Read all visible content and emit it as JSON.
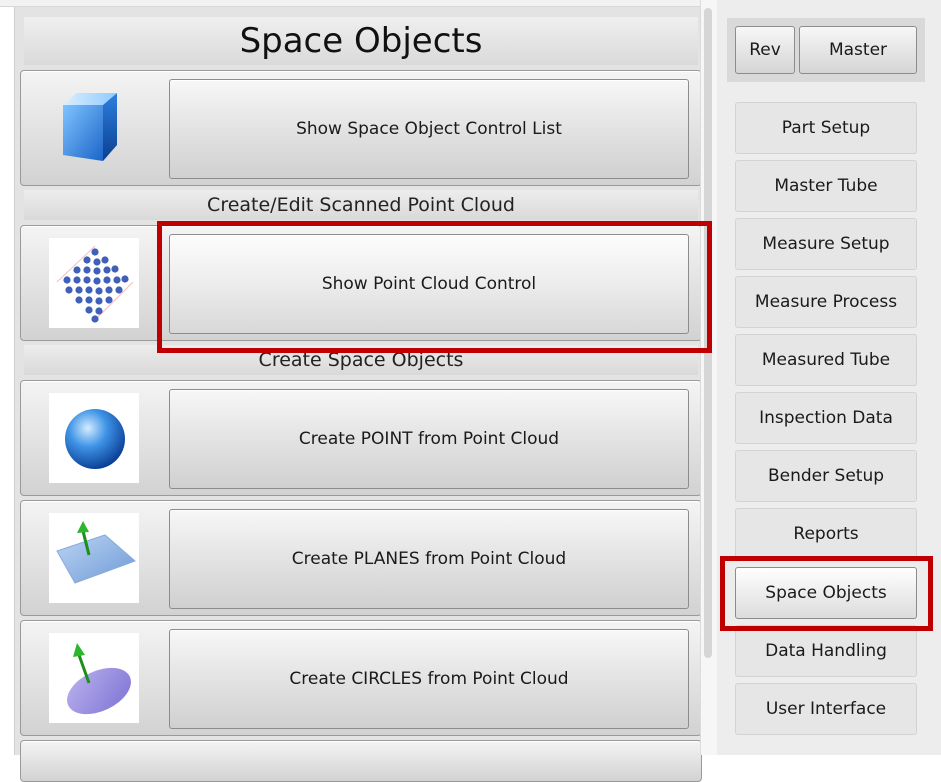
{
  "left": {
    "title": "Space Objects",
    "show_control_list": "Show Space Object Control List",
    "section_scanned": "Create/Edit Scanned Point Cloud",
    "show_point_cloud": "Show Point Cloud Control",
    "section_create": "Create Space Objects",
    "create_point": "Create POINT from Point Cloud",
    "create_planes": "Create PLANES from Point Cloud",
    "create_circles": "Create CIRCLES from Point Cloud"
  },
  "top_buttons": {
    "rev": "Rev",
    "master": "Master"
  },
  "nav": [
    {
      "label": "Part Setup"
    },
    {
      "label": "Master Tube"
    },
    {
      "label": "Measure Setup"
    },
    {
      "label": "Measure Process"
    },
    {
      "label": "Measured Tube"
    },
    {
      "label": "Inspection Data"
    },
    {
      "label": "Bender Setup"
    },
    {
      "label": "Reports"
    },
    {
      "label": "Space Objects"
    },
    {
      "label": "Data Handling"
    },
    {
      "label": "User Interface"
    }
  ],
  "colors": {
    "highlight": "#c00000",
    "panel": "#e3e3e3"
  },
  "icons": [
    "cube-icon",
    "point-cloud-icon",
    "sphere-icon",
    "plane-icon",
    "circle-icon"
  ]
}
